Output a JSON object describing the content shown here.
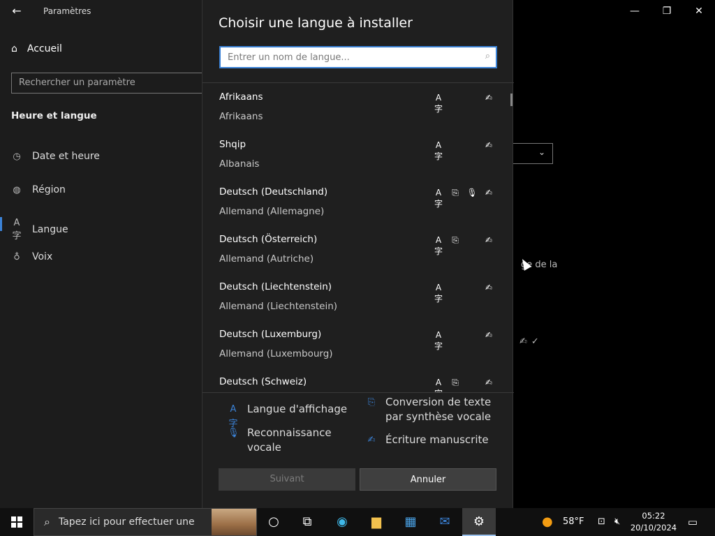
{
  "settings": {
    "app_title": "Paramètres",
    "home_label": "Accueil",
    "search_placeholder": "Rechercher un paramètre",
    "section_title": "Heure et langue",
    "nav_items": [
      {
        "label": "Date et heure",
        "icon": "calendar-clock-icon"
      },
      {
        "label": "Région",
        "icon": "globe-icon"
      },
      {
        "label": "Langue",
        "icon": "language-icon"
      },
      {
        "label": "Voix",
        "icon": "microphone-icon"
      }
    ],
    "selected_index": 2,
    "bg_text": "ge de la"
  },
  "dialog": {
    "title": "Choisir une langue à installer",
    "search_placeholder": "Entrer un nom de langue...",
    "languages": [
      {
        "name": "Afrikaans",
        "sub": "Afrikaans",
        "features": [
          "display",
          "handwriting"
        ]
      },
      {
        "name": "Shqip",
        "sub": "Albanais",
        "features": [
          "display",
          "handwriting"
        ]
      },
      {
        "name": "Deutsch (Deutschland)",
        "sub": "Allemand (Allemagne)",
        "features": [
          "display",
          "tts",
          "speech",
          "handwriting"
        ]
      },
      {
        "name": "Deutsch (Österreich)",
        "sub": "Allemand (Autriche)",
        "features": [
          "display",
          "tts",
          "handwriting"
        ]
      },
      {
        "name": "Deutsch (Liechtenstein)",
        "sub": "Allemand (Liechtenstein)",
        "features": [
          "display",
          "handwriting"
        ]
      },
      {
        "name": "Deutsch (Luxemburg)",
        "sub": "Allemand (Luxembourg)",
        "features": [
          "display",
          "handwriting"
        ]
      },
      {
        "name": "Deutsch (Schweiz)",
        "sub": "",
        "features": [
          "display",
          "tts",
          "handwriting"
        ]
      }
    ],
    "legend": {
      "display": "Langue d'affichage",
      "tts_line1": "Conversion de texte",
      "tts_line2": "par synthèse vocale",
      "speech_line1": "Reconnaissance",
      "speech_line2": "vocale",
      "handwriting": "Écriture manuscrite"
    },
    "next_label": "Suivant",
    "cancel_label": "Annuler"
  },
  "taskbar": {
    "search_placeholder": "Tapez ici pour effectuer une",
    "temperature": "58°F",
    "time": "05:22",
    "date": "20/10/2024"
  },
  "colors": {
    "accent": "#3b82d6",
    "dialog_bg": "#1f1f1f",
    "sidebar_bg": "#1c1c1c"
  }
}
